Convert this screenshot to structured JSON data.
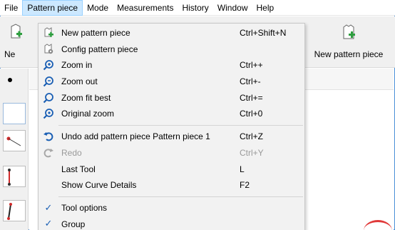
{
  "menubar": {
    "items": [
      {
        "label": "File",
        "active": false
      },
      {
        "label": "Pattern piece",
        "active": true
      },
      {
        "label": "Mode",
        "active": false
      },
      {
        "label": "Measurements",
        "active": false
      },
      {
        "label": "History",
        "active": false
      },
      {
        "label": "Window",
        "active": false
      },
      {
        "label": "Help",
        "active": false
      }
    ]
  },
  "toolbar": {
    "left_button_label": "Ne",
    "right_button_label": "New pattern piece"
  },
  "colors": {
    "accent_blue": "#4a8fd8",
    "menu_highlight": "#cce8ff",
    "icon_blue": "#1a5fb4",
    "icon_green": "#2e9e3f",
    "alert_red": "#e03a3a"
  },
  "dropdown": {
    "groups": [
      [
        {
          "label": "New pattern piece",
          "shortcut": "Ctrl+Shift+N",
          "icon": "new-piece-icon",
          "enabled": true
        },
        {
          "label": "Config pattern piece",
          "shortcut": "",
          "icon": "config-piece-icon",
          "enabled": true
        },
        {
          "label": "Zoom in",
          "shortcut": "Ctrl++",
          "icon": "zoom-in-icon",
          "enabled": true
        },
        {
          "label": "Zoom out",
          "shortcut": "Ctrl+-",
          "icon": "zoom-out-icon",
          "enabled": true
        },
        {
          "label": "Zoom fit best",
          "shortcut": "Ctrl+=",
          "icon": "zoom-fit-icon",
          "enabled": true
        },
        {
          "label": "Original zoom",
          "shortcut": "Ctrl+0",
          "icon": "original-zoom-icon",
          "enabled": true
        }
      ],
      [
        {
          "label": "Undo add pattern piece Pattern piece 1",
          "shortcut": "Ctrl+Z",
          "icon": "undo-icon",
          "enabled": true
        },
        {
          "label": "Redo",
          "shortcut": "Ctrl+Y",
          "icon": "redo-icon",
          "enabled": false
        },
        {
          "label": "Last Tool",
          "shortcut": "L",
          "icon": "",
          "enabled": true
        },
        {
          "label": "Show Curve Details",
          "shortcut": "F2",
          "icon": "",
          "enabled": true
        }
      ],
      [
        {
          "label": "Tool options",
          "shortcut": "",
          "icon": "check-icon",
          "enabled": true,
          "checked": true
        },
        {
          "label": "Group",
          "shortcut": "",
          "icon": "check-icon",
          "enabled": true,
          "checked": true
        }
      ]
    ]
  }
}
